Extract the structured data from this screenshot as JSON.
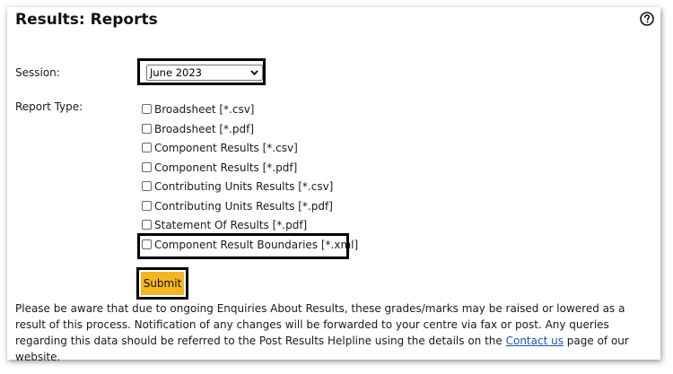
{
  "header": {
    "title": "Results: Reports",
    "help_icon": "help-circle-icon"
  },
  "form": {
    "session": {
      "label": "Session:",
      "selected": "June 2023"
    },
    "report_type": {
      "label": "Report Type:",
      "options": [
        "Broadsheet [*.csv]",
        "Broadsheet [*.pdf]",
        "Component Results [*.csv]",
        "Component Results [*.pdf]",
        "Contributing Units Results [*.csv]",
        "Contributing Units Results [*.pdf]",
        "Statement Of Results [*.pdf]",
        "Component Result Boundaries [*.xml]"
      ],
      "checked": [
        false,
        false,
        false,
        false,
        false,
        false,
        false,
        false
      ]
    },
    "submit_label": "Submit",
    "submit_color": "#f5b520",
    "highlight_color": "#000000"
  },
  "notice": {
    "text_before": "Please be aware that due to ongoing Enquiries About Results, these grades/marks may be raised or lowered as a result of this process. Notification of any changes will be forwarded to your centre via fax or post. Any queries regarding this data should be referred to the Post Results Helpline using the details on the ",
    "link_text": "Contact us",
    "text_after": " page of our website."
  }
}
